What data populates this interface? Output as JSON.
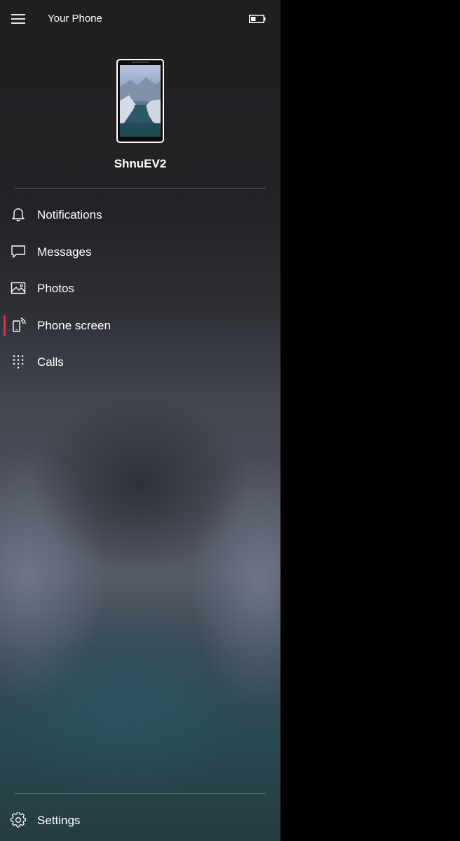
{
  "window": {
    "title": "Your Phone",
    "battery": {
      "icon": "battery-icon",
      "level": 0.4
    }
  },
  "device": {
    "name": "ShnuEV2",
    "image": "phone-thumbnail-icon"
  },
  "nav": {
    "items": [
      {
        "label": "Notifications",
        "icon": "bell-icon",
        "active": false
      },
      {
        "label": "Messages",
        "icon": "chat-bubble-icon",
        "active": false
      },
      {
        "label": "Photos",
        "icon": "photos-icon",
        "active": false
      },
      {
        "label": "Phone screen",
        "icon": "phone-screen-icon",
        "active": true
      },
      {
        "label": "Calls",
        "icon": "dialpad-icon",
        "active": false
      }
    ],
    "settings": {
      "label": "Settings",
      "icon": "gear-icon"
    }
  },
  "colors": {
    "accent": "#d6314b",
    "text": "#ffffff",
    "background": "#000000"
  }
}
